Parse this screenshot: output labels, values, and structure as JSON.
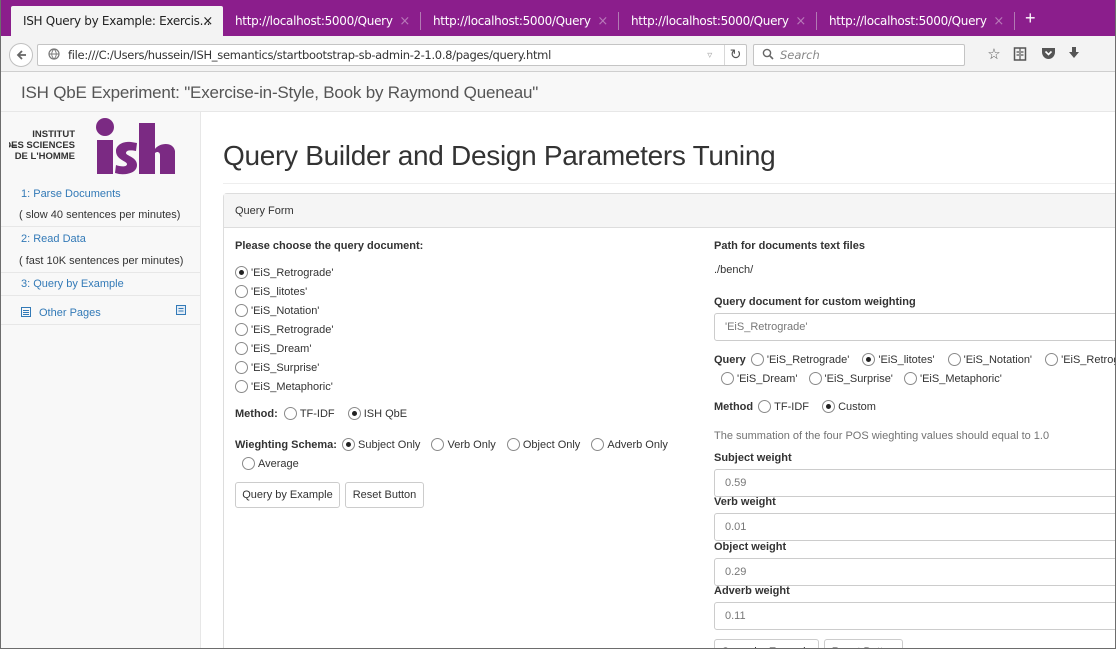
{
  "browser": {
    "tabs": [
      {
        "title": "ISH Query by Example: Exercis...",
        "active": true
      },
      {
        "title": "http://localhost:5000/Query",
        "active": false
      },
      {
        "title": "http://localhost:5000/Query",
        "active": false
      },
      {
        "title": "http://localhost:5000/Query",
        "active": false
      },
      {
        "title": "http://localhost:5000/Query",
        "active": false
      }
    ],
    "tab_close_glyph": "×",
    "new_tab_glyph": "+",
    "url": "file:///C:/Users/hussein/ISH_semantics/startbootstrap-sb-admin-2-1.0.8/pages/query.html",
    "search_placeholder": "Search",
    "accent": "#8b1e8c"
  },
  "header": {
    "brand": "ISH QbE Experiment: \"Exercise-in-Style, Book by Raymond Queneau\""
  },
  "sidebar": {
    "logo": {
      "line1": "INSTITUT",
      "line2": "DES SCIENCES",
      "line3": "DE L'HOMME",
      "mark": "ish",
      "color": "#7b2a83"
    },
    "items": [
      {
        "label": "1: Parse Documents",
        "type": "link"
      },
      {
        "label": "( slow 40 sentences per minutes)",
        "type": "note"
      },
      {
        "label": "2: Read Data",
        "type": "link"
      },
      {
        "label": "( fast 10K sentences per minutes)",
        "type": "note"
      },
      {
        "label": "3: Query by Example",
        "type": "link"
      },
      {
        "label": "Other Pages",
        "type": "link",
        "icon": "list-icon"
      }
    ]
  },
  "main": {
    "title": "Query Builder and Design Parameters Tuning",
    "panel_heading": "Query Form",
    "left": {
      "doc_label": "Please choose the query document:",
      "documents": [
        {
          "label": "'EiS_Retrograde'",
          "checked": true
        },
        {
          "label": "'EiS_litotes'",
          "checked": false
        },
        {
          "label": "'EiS_Notation'",
          "checked": false
        },
        {
          "label": "'EiS_Retrograde'",
          "checked": false
        },
        {
          "label": "'EiS_Dream'",
          "checked": false
        },
        {
          "label": "'EiS_Surprise'",
          "checked": false
        },
        {
          "label": "'EiS_Metaphoric'",
          "checked": false
        }
      ],
      "method_label": "Method:",
      "methods": [
        {
          "label": "TF-IDF",
          "checked": false
        },
        {
          "label": "ISH QbE",
          "checked": true
        }
      ],
      "schema_label": "Wieghting Schema:",
      "schemas": [
        {
          "label": "Subject Only",
          "checked": true
        },
        {
          "label": "Verb Only",
          "checked": false
        },
        {
          "label": "Object Only",
          "checked": false
        },
        {
          "label": "Adverb Only",
          "checked": false
        },
        {
          "label": "Average",
          "checked": false
        }
      ],
      "query_button": "Query by Example",
      "reset_button": "Reset Button"
    },
    "right": {
      "path_label": "Path for documents text files",
      "path_value": "./bench/",
      "custom_doc_label": "Query document for custom weighting",
      "custom_doc_value": "'EiS_Retrograde'",
      "query_label": "Query",
      "query_options": [
        {
          "label": "'EiS_Retrograde'",
          "checked": false
        },
        {
          "label": "'EiS_litotes'",
          "checked": true
        },
        {
          "label": "'EiS_Notation'",
          "checked": false
        },
        {
          "label": "'EiS_Retrograde'",
          "checked": false
        },
        {
          "label": "'EiS_Dream'",
          "checked": false
        },
        {
          "label": "'EiS_Surprise'",
          "checked": false
        },
        {
          "label": "'EiS_Metaphoric'",
          "checked": false
        }
      ],
      "method_label": "Method",
      "methods": [
        {
          "label": "TF-IDF",
          "checked": false
        },
        {
          "label": "Custom",
          "checked": true
        }
      ],
      "hint": "The summation of the four POS wieghting values should equal to 1.0",
      "weights": [
        {
          "label": "Subject weight",
          "value": "0.59"
        },
        {
          "label": "Verb weight",
          "value": "0.01"
        },
        {
          "label": "Object weight",
          "value": "0.29"
        },
        {
          "label": "Adverb weight",
          "value": "0.11"
        }
      ],
      "query_button": "Query by Example",
      "reset_button": "Reset Button"
    }
  }
}
